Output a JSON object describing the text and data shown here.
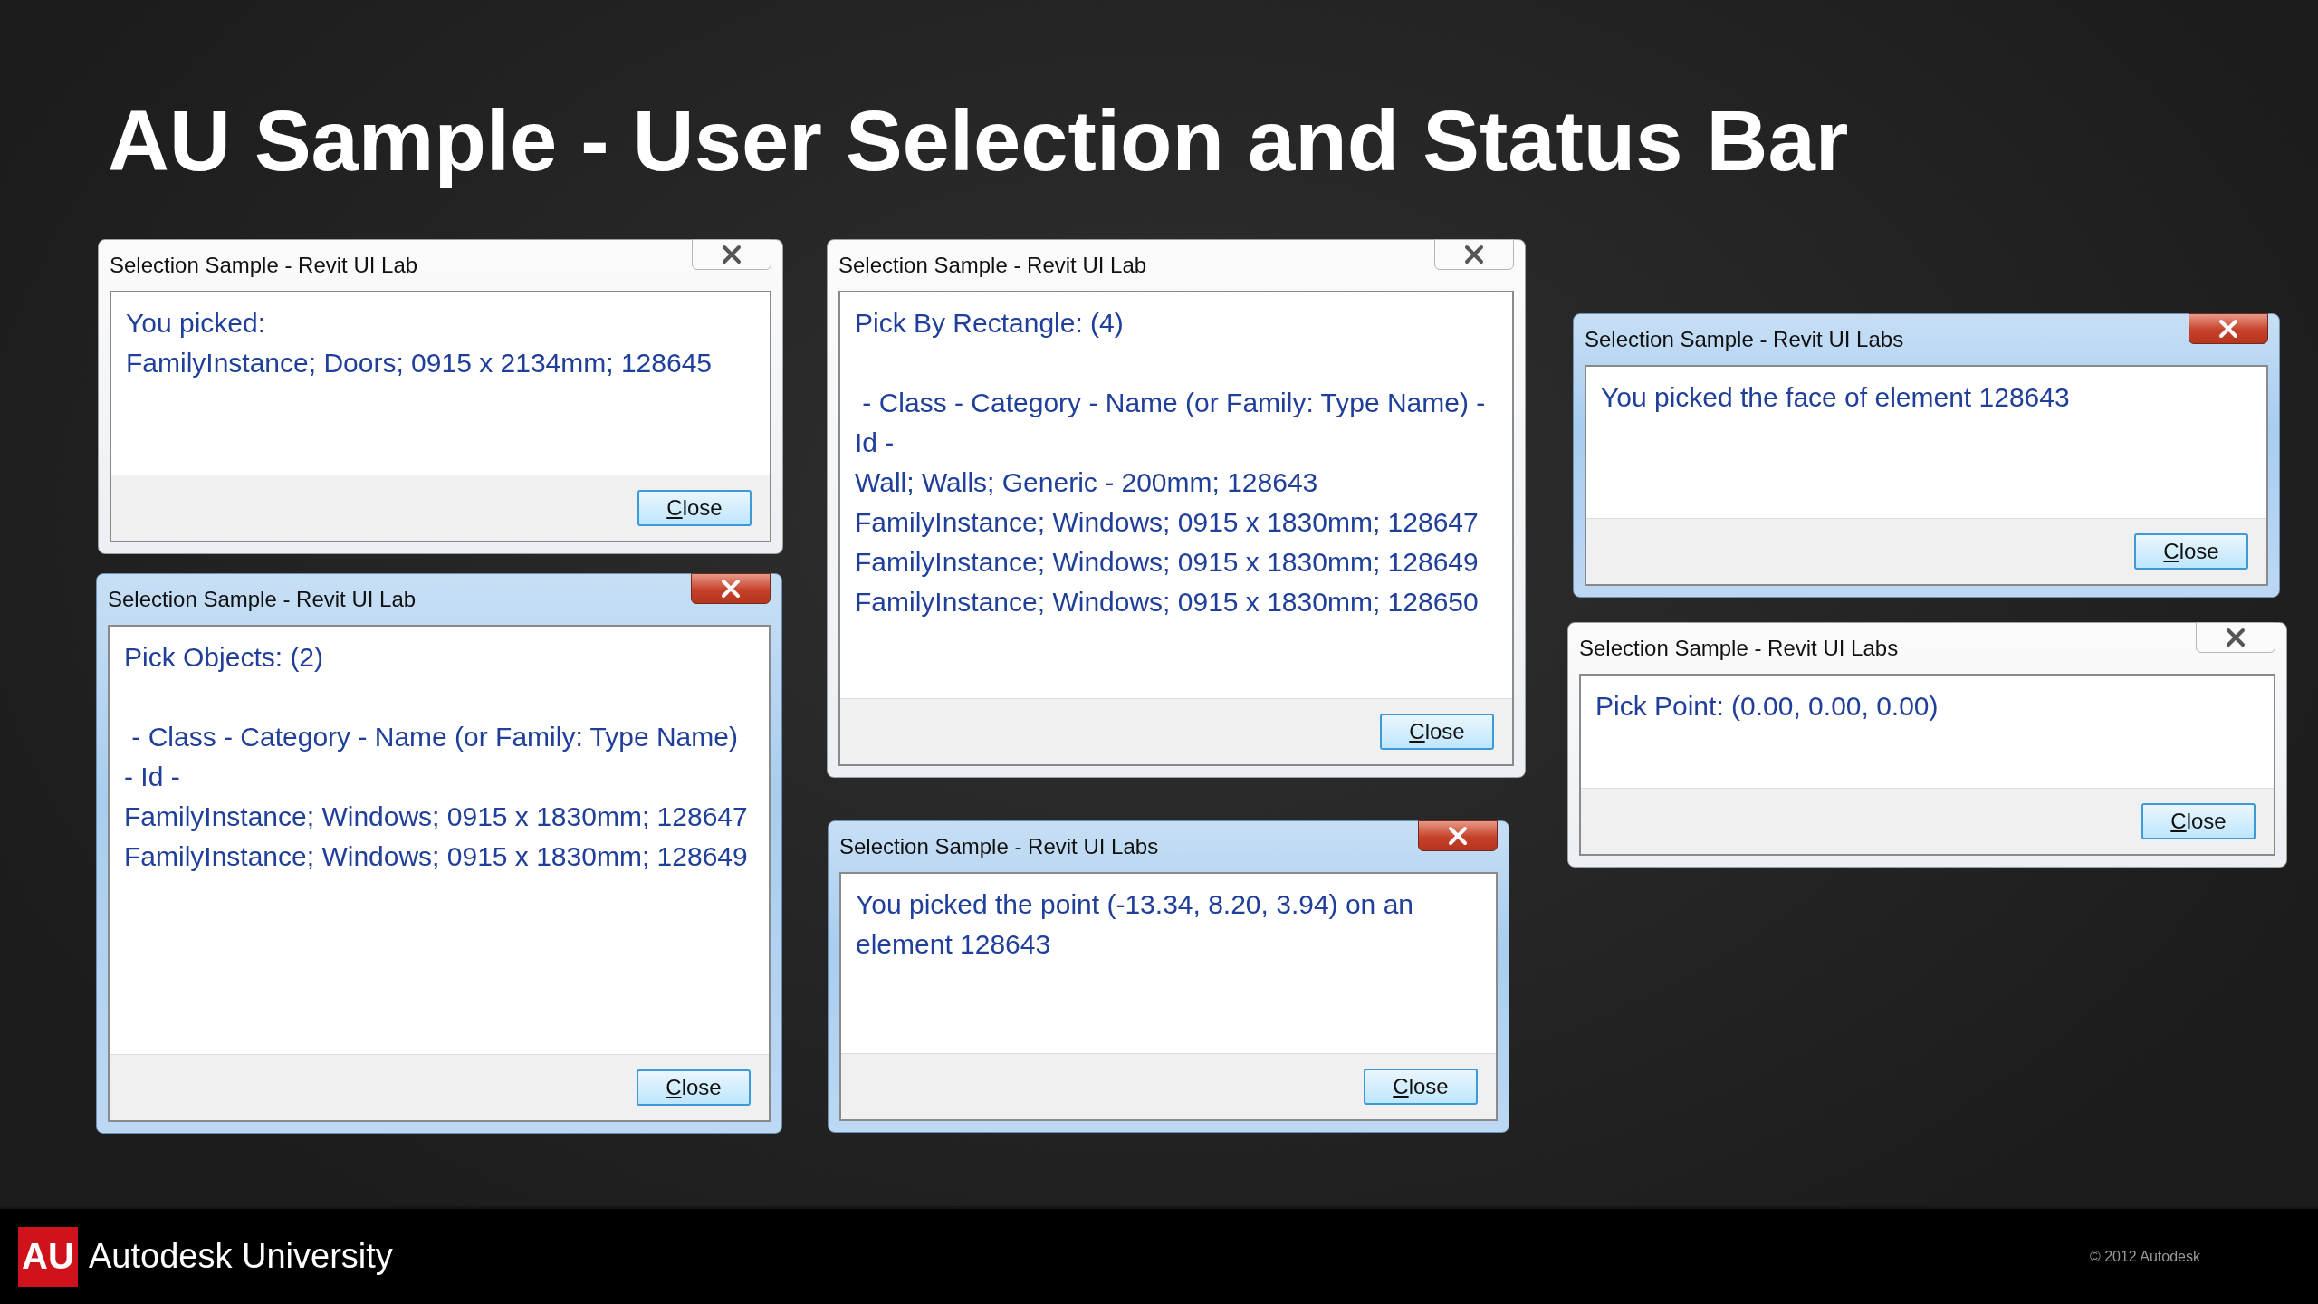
{
  "slide_title": "AU Sample - User Selection and Status Bar",
  "dialogs": [
    {
      "title": "Selection Sample - Revit UI Lab",
      "active": false,
      "paragraphs": [
        [
          "You picked:",
          "FamilyInstance; Doors; 0915 x 2134mm; 128645"
        ]
      ],
      "button": "Close"
    },
    {
      "title": "Selection Sample - Revit UI Lab",
      "active": true,
      "paragraphs": [
        [
          "Pick Objects: (2)"
        ],
        [
          " - Class - Category - Name (or Family: Type Name) - Id -",
          "FamilyInstance; Windows; 0915 x 1830mm; 128647",
          "FamilyInstance; Windows; 0915 x 1830mm; 128649"
        ]
      ],
      "button": "Close"
    },
    {
      "title": "Selection Sample - Revit UI Lab",
      "active": false,
      "paragraphs": [
        [
          "Pick By Rectangle: (4)"
        ],
        [
          " - Class - Category - Name (or Family: Type Name) - Id -",
          "Wall; Walls; Generic - 200mm; 128643",
          "FamilyInstance; Windows; 0915 x 1830mm; 128647",
          "FamilyInstance; Windows; 0915 x 1830mm; 128649",
          "FamilyInstance; Windows; 0915 x 1830mm; 128650"
        ]
      ],
      "button": "Close"
    },
    {
      "title": "Selection Sample - Revit UI Labs",
      "active": true,
      "paragraphs": [
        [
          "You picked the point (-13.34, 8.20, 3.94) on an element 128643"
        ]
      ],
      "button": "Close"
    },
    {
      "title": "Selection Sample - Revit UI Labs",
      "active": true,
      "paragraphs": [
        [
          "You picked the face of element 128643"
        ]
      ],
      "button": "Close"
    },
    {
      "title": "Selection Sample - Revit UI Labs",
      "active": false,
      "paragraphs": [
        [
          "Pick Point: (0.00, 0.00, 0.00)"
        ]
      ],
      "button": "Close"
    }
  ],
  "footer": {
    "logo": "AU",
    "brand": "Autodesk University",
    "copyright": "© 2012 Autodesk"
  }
}
